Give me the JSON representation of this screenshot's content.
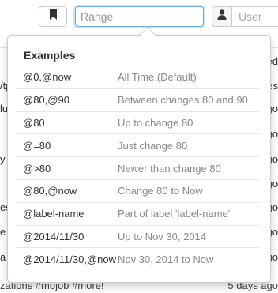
{
  "toolbar": {
    "range_placeholder": "Range",
    "user_placeholder": "User"
  },
  "icons": {
    "bookmark": "bookmark-icon",
    "user": "user-icon"
  },
  "background": {
    "left_fragments": [
      "/tp",
      "lu",
      "y",
      "es",
      "e",
      "a"
    ],
    "right_fragments": [
      "ed",
      "es",
      "go",
      "go",
      "go",
      "go",
      "go",
      "go",
      "go",
      "go"
    ],
    "bottom_left": "zations #mojob #more!",
    "bottom_right": "5 days ago"
  },
  "popover": {
    "title": "Examples",
    "examples": [
      {
        "code": "@0,@now",
        "desc": "All Time (Default)"
      },
      {
        "code": "@80,@90",
        "desc": "Between changes 80 and 90"
      },
      {
        "code": "@80",
        "desc": "Up to change 80"
      },
      {
        "code": "@=80",
        "desc": "Just change 80"
      },
      {
        "code": "@>80",
        "desc": "Newer than change 80"
      },
      {
        "code": "@80,@now",
        "desc": "Change 80 to Now"
      },
      {
        "code": "@label-name",
        "desc": "Part of label 'label-name'"
      },
      {
        "code": "@2014/11/30",
        "desc": "Up to Nov 30, 2014"
      },
      {
        "code": "@2014/11/30,@now",
        "desc": "Nov 30, 2014 to Now"
      }
    ]
  }
}
